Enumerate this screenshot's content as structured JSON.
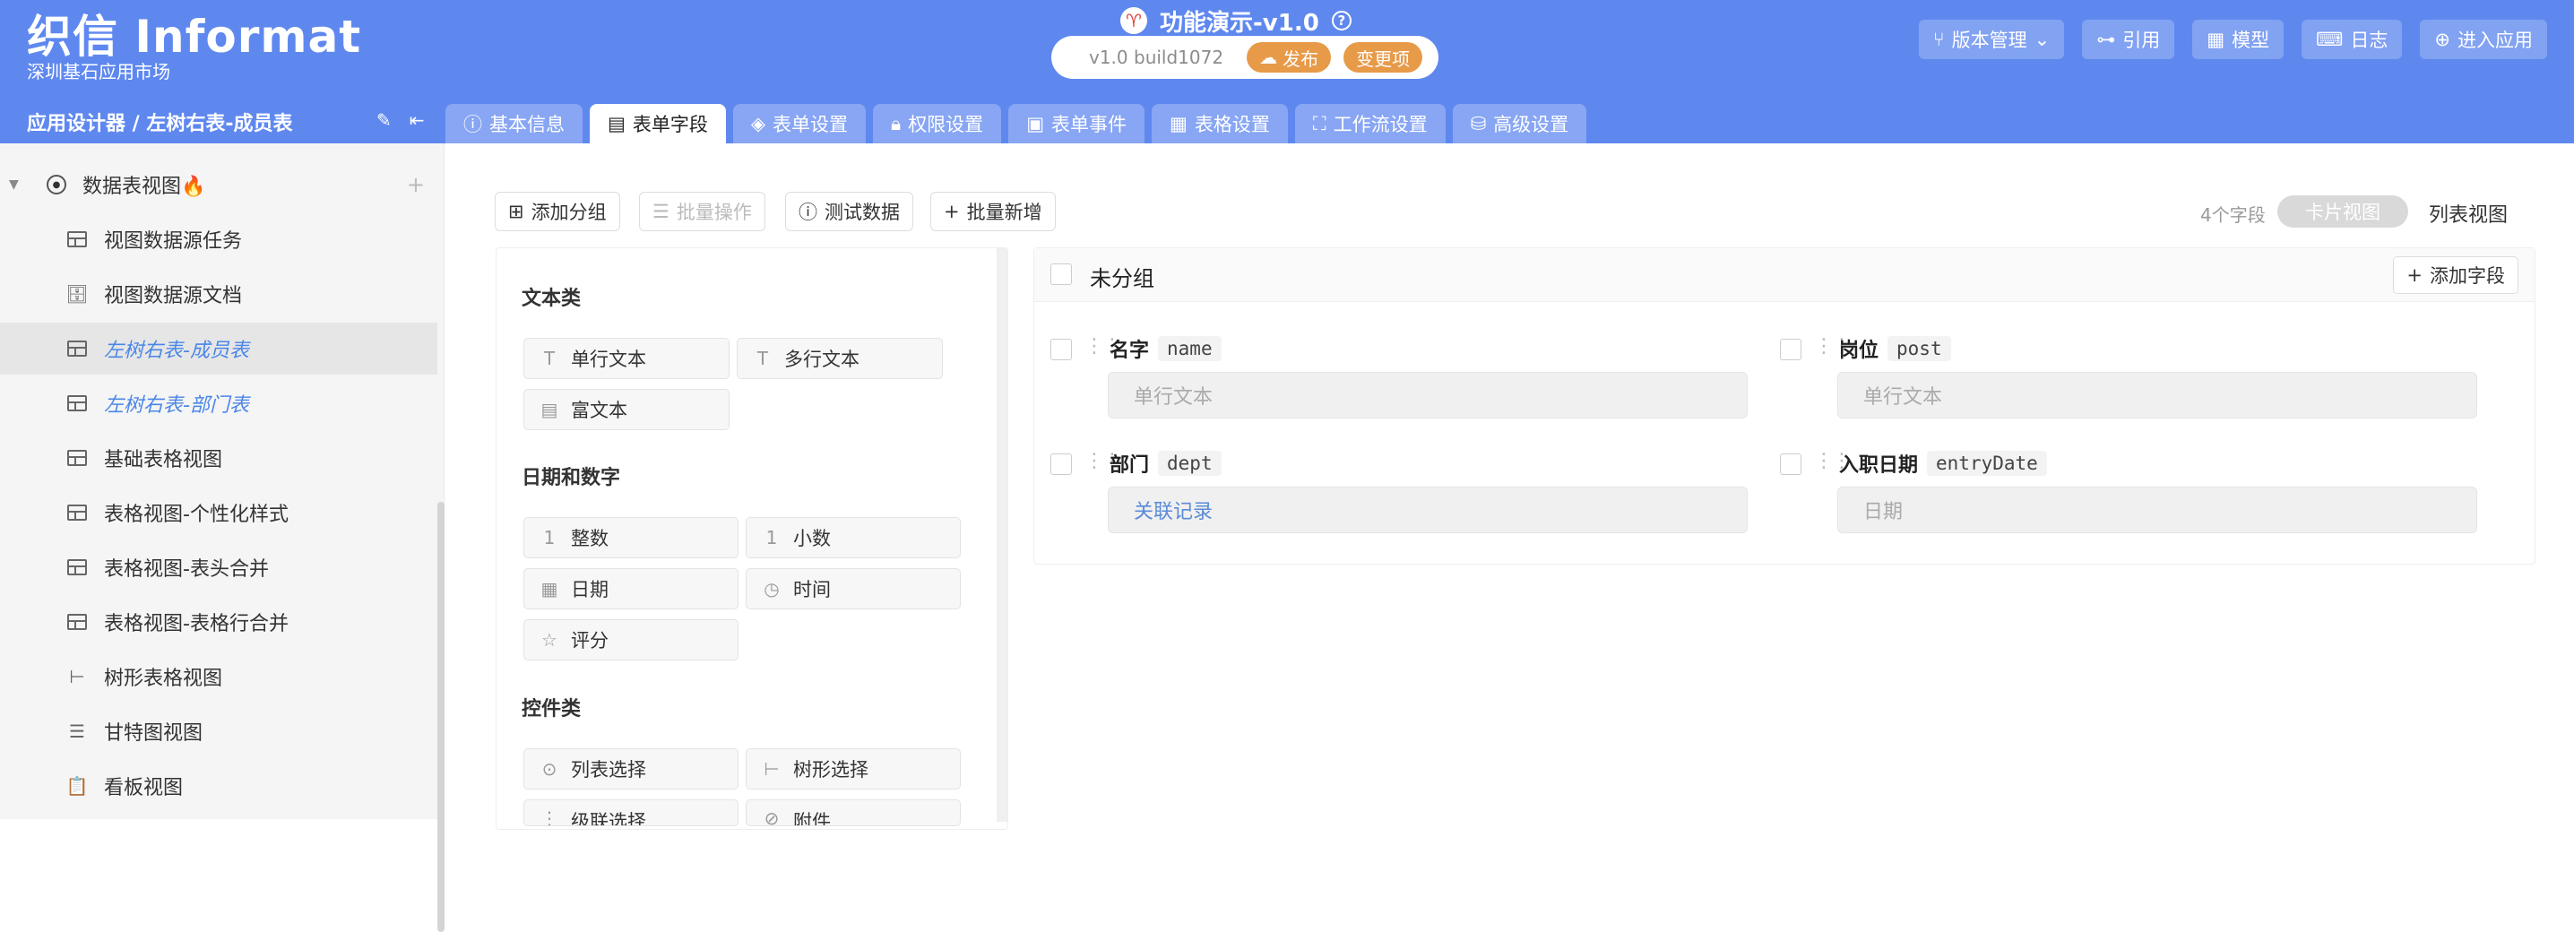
{
  "header": {
    "logo_title": "织信 Informat",
    "logo_subtitle": "深圳基石应用市场",
    "app_title": "功能演示-v1.0",
    "version": "v1.0 build1072",
    "publish_label": "发布",
    "changes_label": "变更项",
    "actions": [
      "版本管理",
      "引用",
      "模型",
      "日志",
      "进入应用"
    ],
    "breadcrumb": "应用设计器 / 左树右表-成员表"
  },
  "tabs": [
    {
      "label": "基本信息",
      "icon": "info-icon",
      "active": false
    },
    {
      "label": "表单字段",
      "icon": "form-icon",
      "active": true
    },
    {
      "label": "表单设置",
      "icon": "layers-icon",
      "active": false
    },
    {
      "label": "权限设置",
      "icon": "lock-icon",
      "active": false
    },
    {
      "label": "表单事件",
      "icon": "image-icon",
      "active": false
    },
    {
      "label": "表格设置",
      "icon": "table-icon",
      "active": false
    },
    {
      "label": "工作流设置",
      "icon": "workflow-icon",
      "active": false
    },
    {
      "label": "高级设置",
      "icon": "database-icon",
      "active": false
    }
  ],
  "sidebar": {
    "section_label": "数据表视图🔥",
    "items": [
      {
        "label": "视图数据源任务",
        "icon": "table-icon"
      },
      {
        "label": "视图数据源文档",
        "icon": "file-cabinet-icon"
      },
      {
        "label": "左树右表-成员表",
        "icon": "table-icon"
      },
      {
        "label": "左树右表-部门表",
        "icon": "table-icon"
      },
      {
        "label": "基础表格视图",
        "icon": "table-icon"
      },
      {
        "label": "表格视图-个性化样式",
        "icon": "table-icon"
      },
      {
        "label": "表格视图-表头合并",
        "icon": "table-icon"
      },
      {
        "label": "表格视图-表格行合并",
        "icon": "table-icon"
      },
      {
        "label": "树形表格视图",
        "icon": "tree-icon"
      },
      {
        "label": "甘特图视图",
        "icon": "gantt-icon"
      },
      {
        "label": "看板视图",
        "icon": "clipboard-icon"
      }
    ]
  },
  "toolbar": {
    "add_group": "添加分组",
    "batch_ops": "批量操作",
    "test_data": "测试数据",
    "batch_add": "批量新增",
    "field_count": "4个字段",
    "card_view": "卡片视图",
    "list_view": "列表视图"
  },
  "palette": {
    "sections": [
      "文本类",
      "日期和数字",
      "控件类"
    ],
    "text_items": [
      "单行文本",
      "多行文本",
      "富文本"
    ],
    "datenum_items": [
      "整数",
      "小数",
      "日期",
      "时间",
      "评分"
    ],
    "control_items": [
      "列表选择",
      "树形选择",
      "级联选择",
      "附件"
    ]
  },
  "group": {
    "title": "未分组",
    "add_field": "添加字段",
    "fields": [
      {
        "label": "名字",
        "code": "name",
        "placeholder": "单行文本"
      },
      {
        "label": "岗位",
        "code": "post",
        "placeholder": "单行文本"
      },
      {
        "label": "部门",
        "code": "dept",
        "placeholder": "关联记录"
      },
      {
        "label": "入职日期",
        "code": "entryDate",
        "placeholder": "日期"
      }
    ]
  }
}
